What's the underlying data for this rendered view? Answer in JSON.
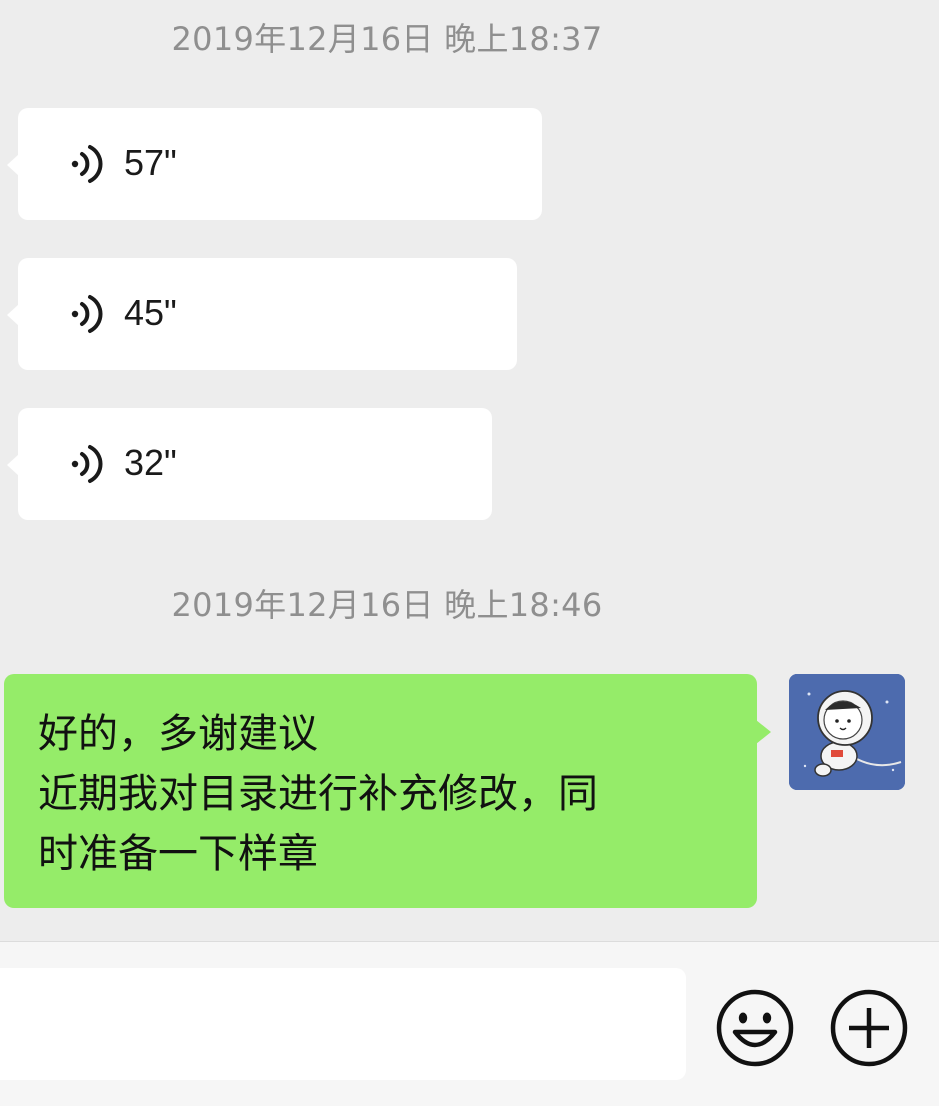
{
  "chat": {
    "messages": [
      {
        "type": "timestamp",
        "text": "2019年12月16日 晚上18:37"
      },
      {
        "type": "voice",
        "duration": "57\""
      },
      {
        "type": "voice",
        "duration": "45\""
      },
      {
        "type": "voice",
        "duration": "32\""
      },
      {
        "type": "timestamp",
        "text": "2019年12月16日 晚上18:46"
      },
      {
        "type": "text",
        "sender": "me",
        "lines": [
          "好的，多谢建议",
          "近期我对目录进行补充修改，同",
          "时准备一下样章"
        ]
      }
    ]
  },
  "input_bar": {
    "value": "",
    "emoji_icon": "emoji-icon",
    "plus_icon": "plus-icon"
  },
  "colors": {
    "background": "#ededed",
    "my_bubble": "#95ec69",
    "their_bubble": "#ffffff",
    "timestamp": "#8f8f8f"
  }
}
